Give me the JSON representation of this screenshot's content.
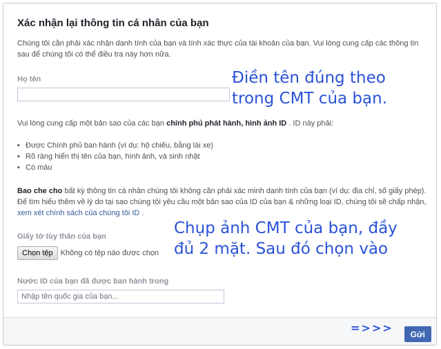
{
  "dialog": {
    "title": "Xác nhận lại thông tin cá nhân của bạn",
    "intro": "Chúng tôi cần phải xác nhận danh tính của bạn và tính xác thực của tài khoản của bạn. Vui lòng cung cấp các thông tin sau để chúng tôi có thể điều tra này hơn nữa."
  },
  "name_field": {
    "label": "Họ tên",
    "value": "",
    "placeholder": ""
  },
  "id_request": {
    "text_prefix": "Vui lòng cung cấp một bản sao của các bạn ",
    "text_bold": "chính phủ phát hành, hình ảnh ID",
    "text_suffix": " . ID này phải:",
    "bullet": "▪",
    "requirements": [
      "Được Chính phủ ban hành (ví dụ: hộ chiếu, bằng lái xe)",
      "Rõ ràng hiển thị tên của bạn, hình ảnh, và sinh nhật",
      "Có màu"
    ]
  },
  "policy": {
    "bold": "Bao che cho",
    "text": " bất kỳ thông tin cá nhân chúng tôi không cần phải xác minh danh tính của bạn (ví dụ: địa chỉ, số giấy phép). Để tìm hiểu thêm về lý do tại sao chúng tôi yêu cầu một bản sao của ID của bạn & những loại ID, chúng tôi sẽ chấp nhận, ",
    "link": "xem xét chính sách của chúng tôi ID",
    "end": " ."
  },
  "upload": {
    "label": "Giấy tờ tùy thân của bạn",
    "button_label": "Chọn tệp",
    "status": "Không có tệp nào được chọn"
  },
  "country_field": {
    "label": "Nước ID của bạn đã được ban hành trong",
    "placeholder": "Nhập tên quốc gia của bạn..."
  },
  "footer": {
    "submit_label": "Gửi"
  },
  "annotations": {
    "note1_line1": "Điền tên đúng theo",
    "note1_line2": "trong CMT của bạn.",
    "note2_line1": "Chụp ảnh CMT của bạn, đầy",
    "note2_line2": "đủ 2 mặt. Sau đó chọn vào",
    "arrows": "=>>>"
  },
  "colors": {
    "accent": "#4267b2",
    "link": "#365899",
    "annotation": "#2a52d6"
  }
}
